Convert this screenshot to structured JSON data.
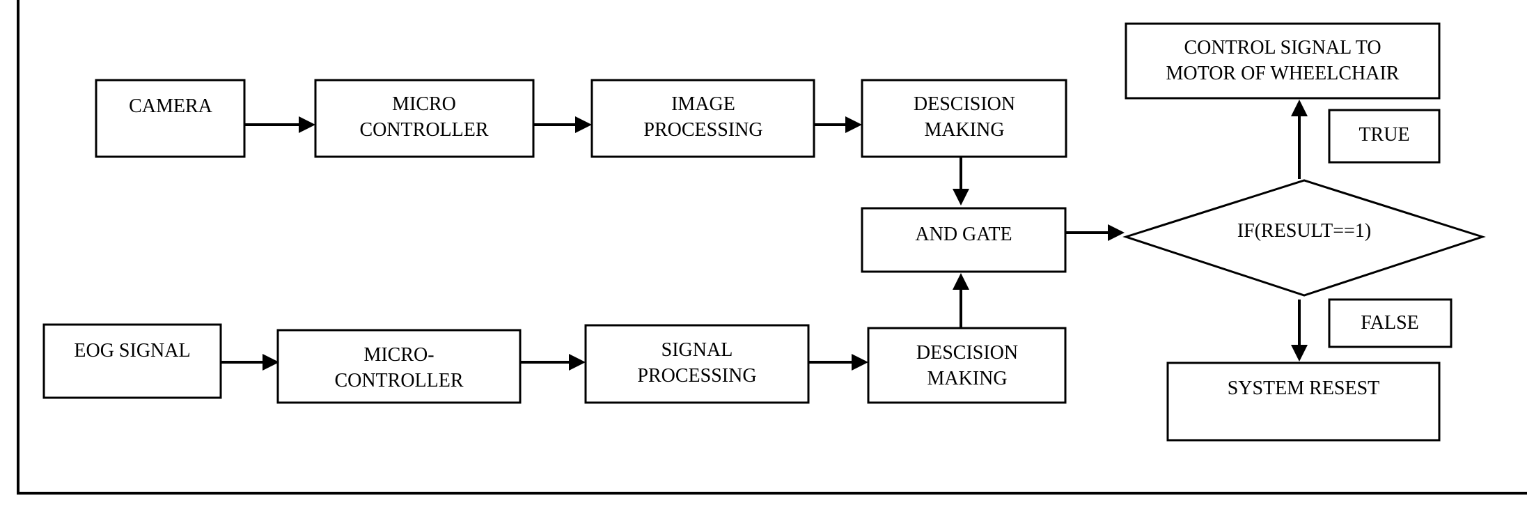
{
  "diagram": {
    "nodes": {
      "camera": {
        "lines": [
          "CAMERA"
        ]
      },
      "micro_controller_top": {
        "lines": [
          "MICRO",
          "CONTROLLER"
        ]
      },
      "image_processing": {
        "lines": [
          "IMAGE",
          "PROCESSING"
        ]
      },
      "decision_top": {
        "lines": [
          "DESCISION",
          "MAKING"
        ]
      },
      "and_gate": {
        "lines": [
          "AND GATE"
        ]
      },
      "condition": {
        "lines": [
          "IF(RESULT==1)"
        ]
      },
      "control_signal": {
        "lines": [
          "CONTROL SIGNAL TO",
          "MOTOR OF WHEELCHAIR"
        ]
      },
      "true_label": {
        "lines": [
          "TRUE"
        ]
      },
      "false_label": {
        "lines": [
          "FALSE"
        ]
      },
      "system_reset": {
        "lines": [
          "SYSTEM RESEST"
        ]
      },
      "eog_signal": {
        "lines": [
          "EOG SIGNAL"
        ]
      },
      "micro_controller_bottom": {
        "lines": [
          "MICRO-",
          "CONTROLLER"
        ]
      },
      "signal_processing": {
        "lines": [
          "SIGNAL",
          "PROCESSING"
        ]
      },
      "decision_bottom": {
        "lines": [
          "DESCISION",
          "MAKING"
        ]
      }
    },
    "edges": [
      [
        "camera",
        "micro_controller_top"
      ],
      [
        "micro_controller_top",
        "image_processing"
      ],
      [
        "image_processing",
        "decision_top"
      ],
      [
        "decision_top",
        "and_gate"
      ],
      [
        "eog_signal",
        "micro_controller_bottom"
      ],
      [
        "micro_controller_bottom",
        "signal_processing"
      ],
      [
        "signal_processing",
        "decision_bottom"
      ],
      [
        "decision_bottom",
        "and_gate"
      ],
      [
        "and_gate",
        "condition"
      ],
      [
        "condition",
        "control_signal",
        "TRUE"
      ],
      [
        "condition",
        "system_reset",
        "FALSE"
      ]
    ]
  }
}
